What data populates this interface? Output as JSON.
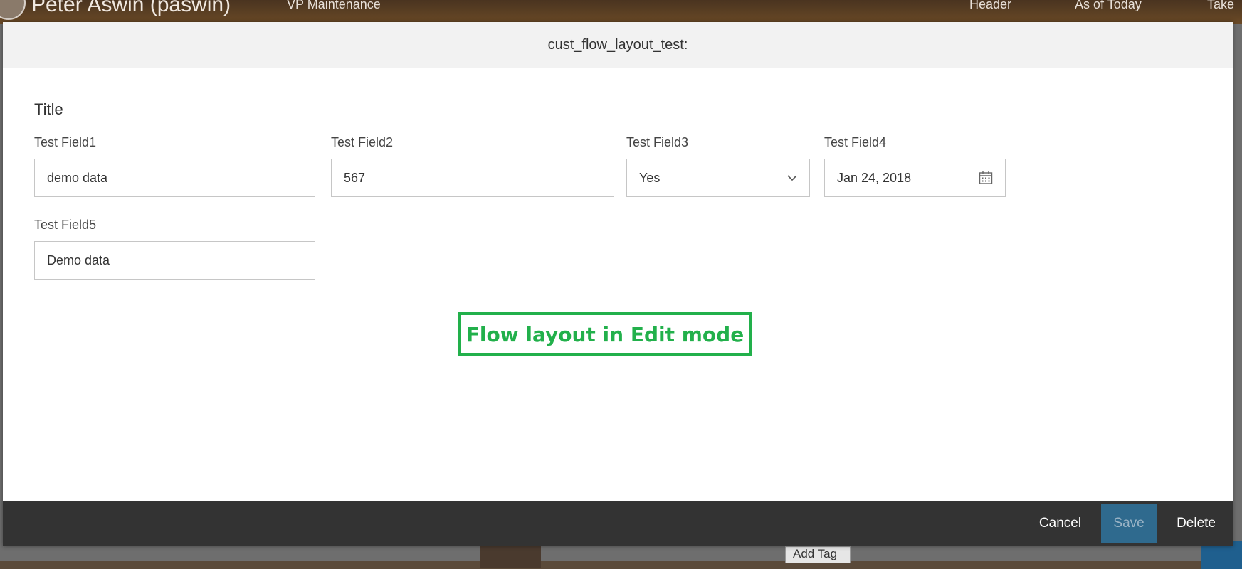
{
  "background": {
    "user_name": "Peter Aswin (paswin)",
    "role": "VP Maintenance",
    "header_link": "Header",
    "as_of": "As of Today",
    "take": "Take",
    "add_tag": "Add Tag"
  },
  "dialog": {
    "title": "cust_flow_layout_test:",
    "section_title": "Title",
    "fields": [
      {
        "label": "Test Field1",
        "value": "demo data"
      },
      {
        "label": "Test Field2",
        "value": "567"
      },
      {
        "label": "Test Field3",
        "value": "Yes"
      },
      {
        "label": "Test Field4",
        "value": "Jan 24, 2018"
      },
      {
        "label": "Test Field5",
        "value": "Demo data"
      }
    ],
    "annotation": "Flow layout in Edit mode",
    "footer": {
      "cancel": "Cancel",
      "save": "Save",
      "delete": "Delete"
    }
  },
  "colors": {
    "annotation": "#22b04b",
    "footer_bg": "#333333",
    "save_bg": "#2f6a8e"
  },
  "icons": {
    "select": "chevron-down-icon",
    "date": "calendar-icon"
  }
}
